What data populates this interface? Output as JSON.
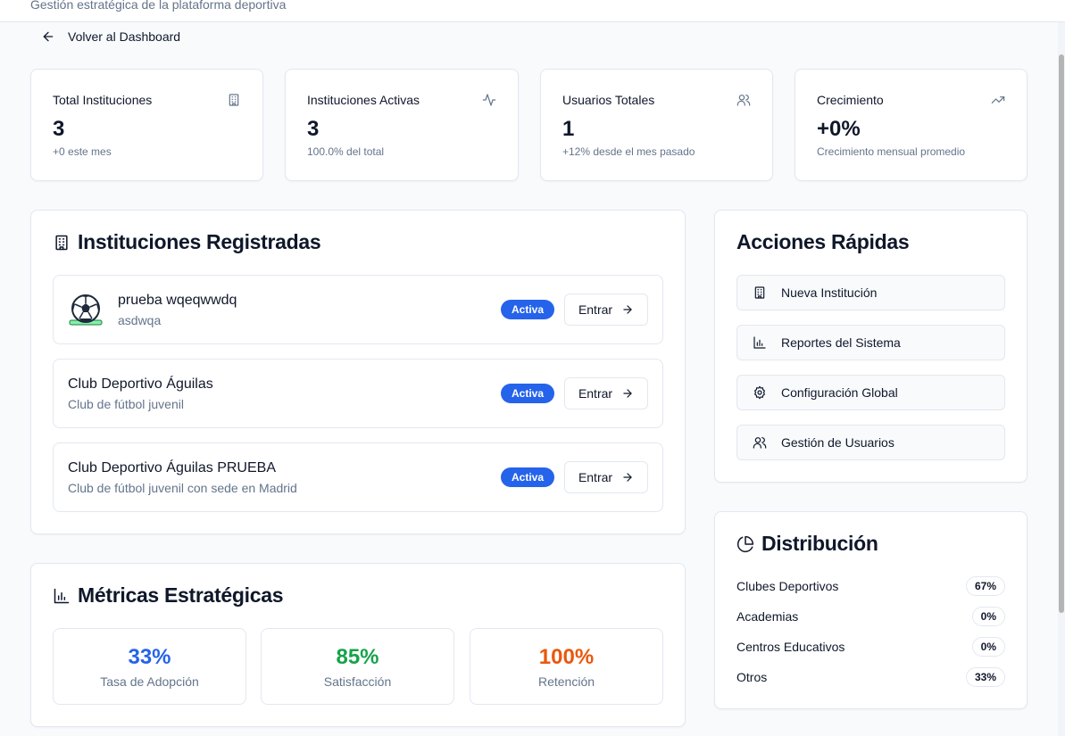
{
  "header": {
    "subtitle": "Gestión estratégica de la plataforma deportiva"
  },
  "back_link": {
    "label": "Volver al Dashboard"
  },
  "stats": [
    {
      "label": "Total Instituciones",
      "value": "3",
      "sub": "+0 este mes",
      "icon": "building-icon"
    },
    {
      "label": "Instituciones Activas",
      "value": "3",
      "sub": "100.0% del total",
      "icon": "activity-icon"
    },
    {
      "label": "Usuarios Totales",
      "value": "1",
      "sub": "+12% desde el mes pasado",
      "icon": "users-icon"
    },
    {
      "label": "Crecimiento",
      "value": "+0%",
      "sub": "Crecimiento mensual promedio",
      "icon": "trending-up-icon"
    }
  ],
  "institutions": {
    "title": "Instituciones Registradas",
    "items": [
      {
        "name": "prueba wqeqwwdq",
        "desc": "asdwqa",
        "badge": "Activa",
        "button": "Entrar",
        "has_logo": true
      },
      {
        "name": "Club Deportivo Águilas",
        "desc": "Club de fútbol juvenil",
        "badge": "Activa",
        "button": "Entrar",
        "has_logo": false
      },
      {
        "name": "Club Deportivo Águilas PRUEBA",
        "desc": "Club de fútbol juvenil con sede en Madrid",
        "badge": "Activa",
        "button": "Entrar",
        "has_logo": false
      }
    ]
  },
  "quick_actions": {
    "title": "Acciones Rápidas",
    "items": [
      {
        "label": "Nueva Institución",
        "icon": "building-icon"
      },
      {
        "label": "Reportes del Sistema",
        "icon": "bar-chart-icon"
      },
      {
        "label": "Configuración Global",
        "icon": "gear-icon"
      },
      {
        "label": "Gestión de Usuarios",
        "icon": "users-icon"
      }
    ]
  },
  "distribution": {
    "title": "Distribución",
    "items": [
      {
        "label": "Clubes Deportivos",
        "value": "67%"
      },
      {
        "label": "Academias",
        "value": "0%"
      },
      {
        "label": "Centros Educativos",
        "value": "0%"
      },
      {
        "label": "Otros",
        "value": "33%"
      }
    ]
  },
  "metrics": {
    "title": "Métricas Estratégicas",
    "items": [
      {
        "value": "33%",
        "label": "Tasa de Adopción",
        "color": "#2563eb"
      },
      {
        "value": "85%",
        "label": "Satisfacción",
        "color": "#16a34a"
      },
      {
        "value": "100%",
        "label": "Retención",
        "color": "#ea580c"
      }
    ]
  },
  "colors": {
    "accent": "#2563eb",
    "border": "#e2e8f0",
    "muted": "#64748b"
  }
}
